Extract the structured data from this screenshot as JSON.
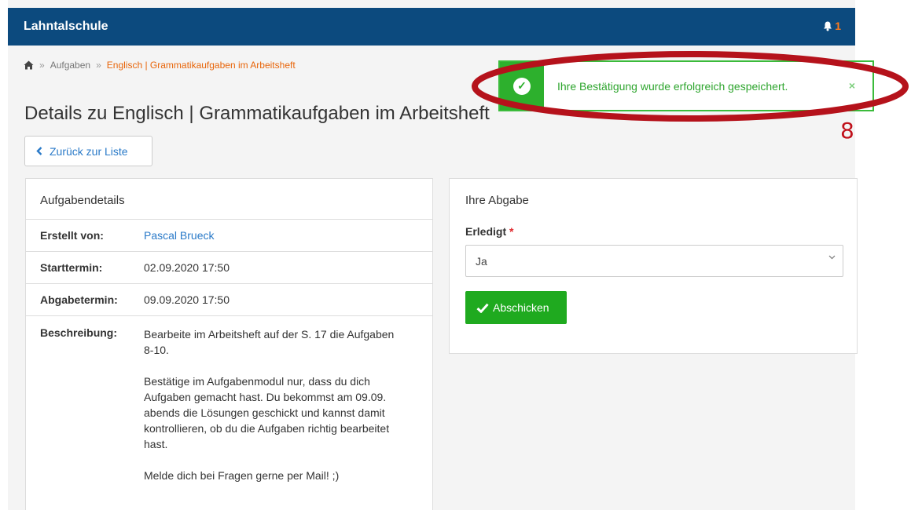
{
  "navbar": {
    "brand": "Lahntalschule",
    "notifications_count": "1"
  },
  "breadcrumb": {
    "items": [
      "Aufgaben",
      "Englisch | Grammatikaufgaben im Arbeitsheft"
    ],
    "separator": "»"
  },
  "page": {
    "title": "Details zu Englisch | Grammatikaufgaben im Arbeitsheft",
    "back_label": "Zurück zur Liste"
  },
  "details": {
    "heading": "Aufgabendetails",
    "rows": [
      {
        "label": "Erstellt von:",
        "value": "Pascal Brueck"
      },
      {
        "label": "Starttermin:",
        "value": "02.09.2020 17:50"
      },
      {
        "label": "Abgabetermin:",
        "value": "09.09.2020 17:50"
      },
      {
        "label": "Beschreibung:",
        "value": ""
      }
    ],
    "description": [
      "Bearbeite im Arbeitsheft auf der S. 17 die Aufgaben 8-10.",
      "Bestätige im Aufgabenmodul nur, dass du dich Aufgaben gemacht hast. Du bekommst am 09.09. abends die Lösungen geschickt und kannst damit kontrollieren, ob du die Aufgaben richtig bearbeitet hast.",
      "Melde dich bei Fragen gerne per Mail! ;)"
    ]
  },
  "submission": {
    "heading": "Ihre Abgabe",
    "field_label": "Erledigt",
    "required_mark": "*",
    "selected": "Ja",
    "submit_label": "Abschicken"
  },
  "toast": {
    "message": "Ihre Bestätigung wurde erfolgreich gespeichert.",
    "close": "×"
  },
  "annotation": {
    "number": "8",
    "color": "#b5121b"
  },
  "colors": {
    "navbar": "#0c4a7e",
    "link": "#2a7ac8",
    "accent_orange": "#e8650a",
    "success": "#1faa1f"
  }
}
